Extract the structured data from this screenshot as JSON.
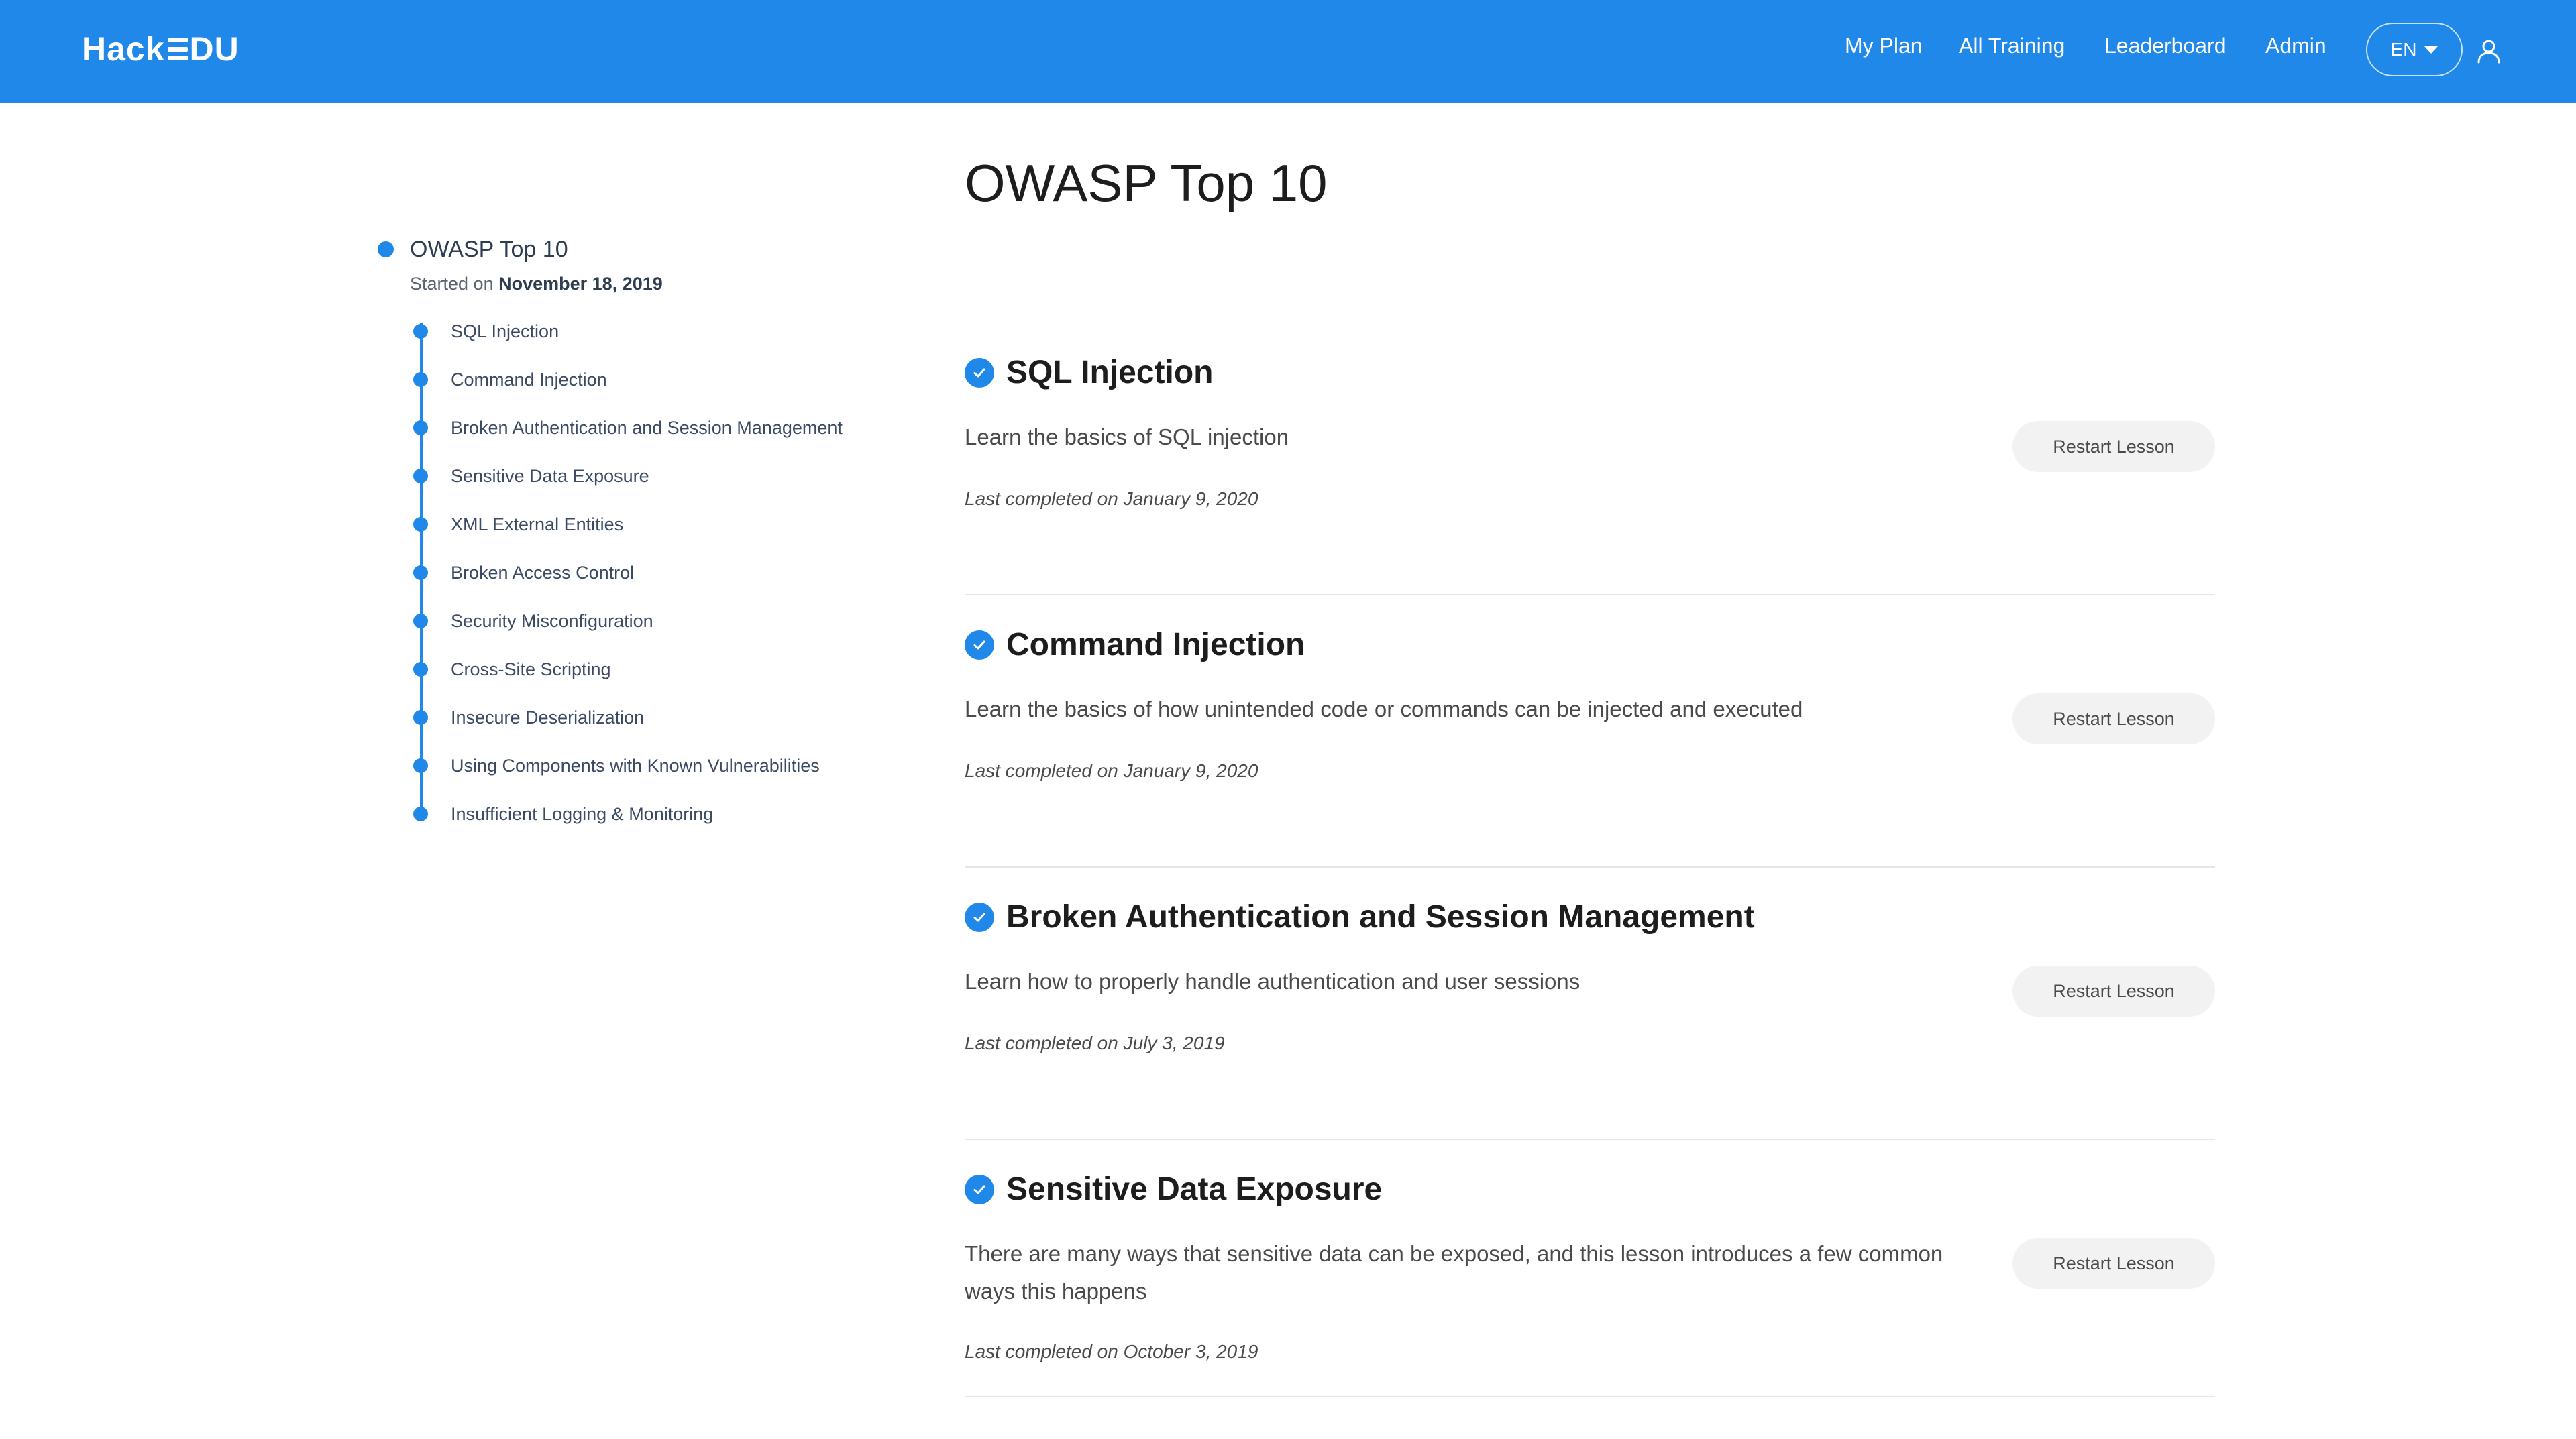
{
  "brand": {
    "logo_left": "Hack",
    "logo_right": "DU"
  },
  "nav": {
    "my_plan": "My Plan",
    "all_training": "All Training",
    "leaderboard": "Leaderboard",
    "admin": "Admin",
    "language": "EN"
  },
  "sidebar": {
    "course_title": "OWASP Top 10",
    "started_prefix": "Started on",
    "started_date": "November 18, 2019",
    "items": [
      {
        "label": "SQL Injection"
      },
      {
        "label": "Command Injection"
      },
      {
        "label": "Broken Authentication and Session Management"
      },
      {
        "label": "Sensitive Data Exposure"
      },
      {
        "label": "XML External Entities"
      },
      {
        "label": "Broken Access Control"
      },
      {
        "label": "Security Misconfiguration"
      },
      {
        "label": "Cross-Site Scripting"
      },
      {
        "label": "Insecure Deserialization"
      },
      {
        "label": "Using Components with Known Vulnerabilities"
      },
      {
        "label": "Insufficient Logging & Monitoring"
      }
    ]
  },
  "main": {
    "title": "OWASP Top 10",
    "restart_label": "Restart Lesson",
    "lessons": [
      {
        "title": "SQL Injection",
        "description": "Learn the basics of SQL injection",
        "completed": "Last completed on January 9, 2020",
        "status": "completed"
      },
      {
        "title": "Command Injection",
        "description": "Learn the basics of how unintended code or commands can be injected and executed",
        "completed": "Last completed on January 9, 2020",
        "status": "completed"
      },
      {
        "title": "Broken Authentication and Session Management",
        "description": "Learn how to properly handle authentication and user sessions",
        "completed": "Last completed on July 3, 2019",
        "status": "completed"
      },
      {
        "title": "Sensitive Data Exposure",
        "description": "There are many ways that sensitive data can be exposed, and this lesson introduces a few common ways this happens",
        "completed": "Last completed on October 3, 2019",
        "status": "completed"
      }
    ]
  },
  "colors": {
    "brand_blue": "#1f88e9",
    "divider": "#e3e6ea",
    "button_bg": "#f2f2f2"
  },
  "icons": {
    "check": "check-circle-icon",
    "user": "user-icon",
    "caret": "caret-down-icon"
  }
}
